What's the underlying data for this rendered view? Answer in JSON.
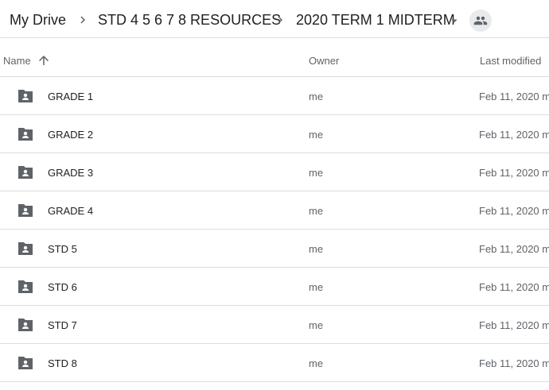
{
  "breadcrumb": {
    "items": [
      "My Drive",
      "STD 4 5 6 7 8 RESOURCES",
      "2020 TERM 1 MIDTERM"
    ]
  },
  "columns": {
    "name": "Name",
    "owner": "Owner",
    "last_modified": "Last modified",
    "sort": "ascending"
  },
  "files": [
    {
      "name": "GRADE 1",
      "owner": "me",
      "modified": "Feb 11, 2020 m"
    },
    {
      "name": "GRADE 2",
      "owner": "me",
      "modified": "Feb 11, 2020 m"
    },
    {
      "name": "GRADE 3",
      "owner": "me",
      "modified": "Feb 11, 2020 m"
    },
    {
      "name": "GRADE 4",
      "owner": "me",
      "modified": "Feb 11, 2020 m"
    },
    {
      "name": "STD 5",
      "owner": "me",
      "modified": "Feb 11, 2020 m"
    },
    {
      "name": "STD 6",
      "owner": "me",
      "modified": "Feb 11, 2020 m"
    },
    {
      "name": "STD 7",
      "owner": "me",
      "modified": "Feb 11, 2020 m"
    },
    {
      "name": "STD 8",
      "owner": "me",
      "modified": "Feb 11, 2020 m"
    }
  ],
  "icons": {
    "separator": "chevron-right-icon",
    "dropdown": "caret-down-icon",
    "shared": "people-icon",
    "sort": "arrow-up-icon",
    "folder": "shared-folder-icon"
  },
  "colors": {
    "text": "#202124",
    "secondary": "#5f6368",
    "divider": "#dadce0",
    "badge_bg": "#e8eaed"
  }
}
